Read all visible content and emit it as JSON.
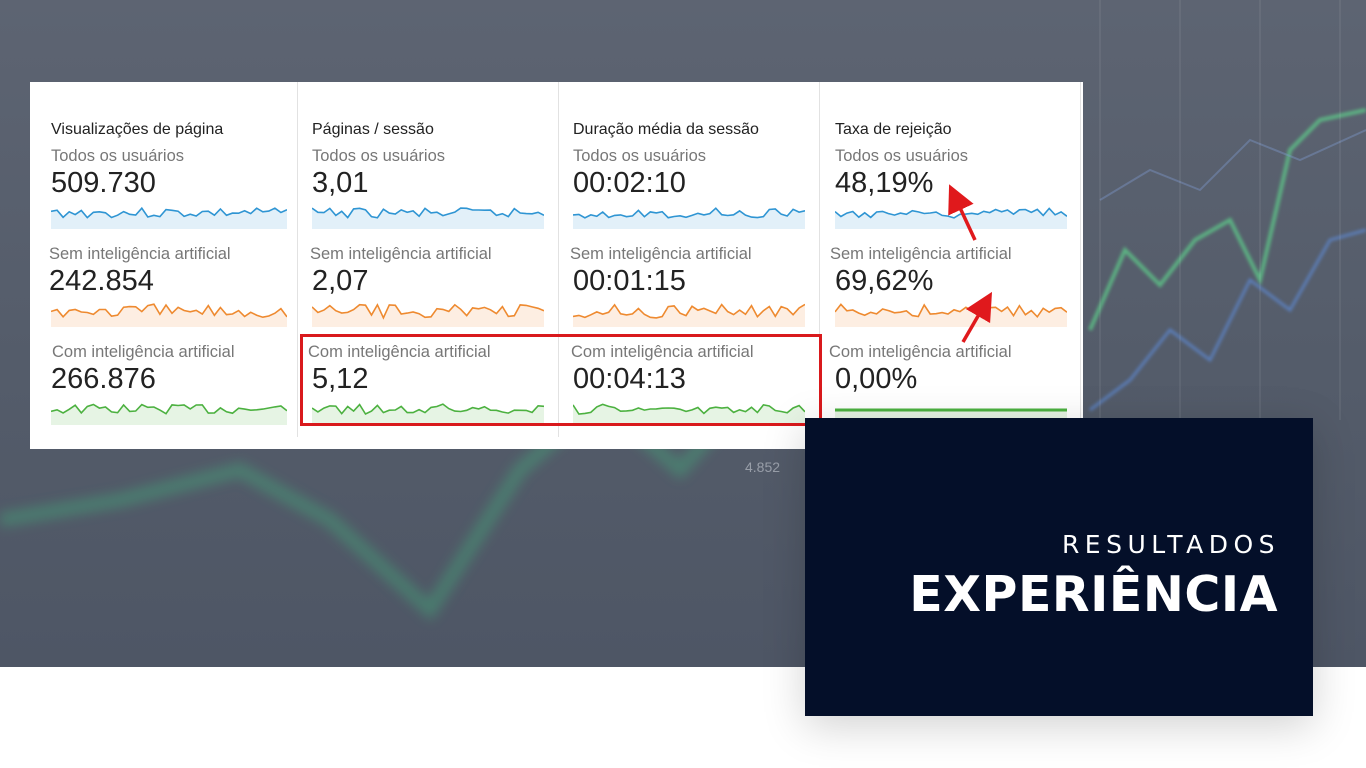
{
  "colors": {
    "blue": "#2f95d3",
    "orange": "#ee8a30",
    "green": "#4cb140",
    "highlight": "#d9191c",
    "card": "#040f29"
  },
  "metrics": [
    {
      "title": "Visualizações de página",
      "segments": [
        {
          "label": "Todos os usuários",
          "value": "509.730",
          "color": "blue"
        },
        {
          "label": "Sem inteligência artificial",
          "value": "242.854",
          "color": "orange"
        },
        {
          "label": "Com inteligência artificial",
          "value": "266.876",
          "color": "green"
        }
      ]
    },
    {
      "title": "Páginas / sessão",
      "segments": [
        {
          "label": "Todos os usuários",
          "value": "3,01",
          "color": "blue"
        },
        {
          "label": "Sem inteligência artificial",
          "value": "2,07",
          "color": "orange"
        },
        {
          "label": "Com inteligência artificial",
          "value": "5,12",
          "color": "green"
        }
      ]
    },
    {
      "title": "Duração média da sessão",
      "segments": [
        {
          "label": "Todos os usuários",
          "value": "00:02:10",
          "color": "blue"
        },
        {
          "label": "Sem inteligência artificial",
          "value": "00:01:15",
          "color": "orange"
        },
        {
          "label": "Com inteligência artificial",
          "value": "00:04:13",
          "color": "green"
        }
      ]
    },
    {
      "title": "Taxa de rejeição",
      "segments": [
        {
          "label": "Todos os usuários",
          "value": "48,19%",
          "color": "blue"
        },
        {
          "label": "Sem inteligência artificial",
          "value": "69,62%",
          "color": "orange"
        },
        {
          "label": "Com inteligência artificial",
          "value": "0,00%",
          "color": "green"
        }
      ]
    }
  ],
  "card": {
    "subtitle": "RESULTADOS",
    "title": "EXPERIÊNCIA"
  },
  "background": {
    "label_1": "4.852"
  }
}
